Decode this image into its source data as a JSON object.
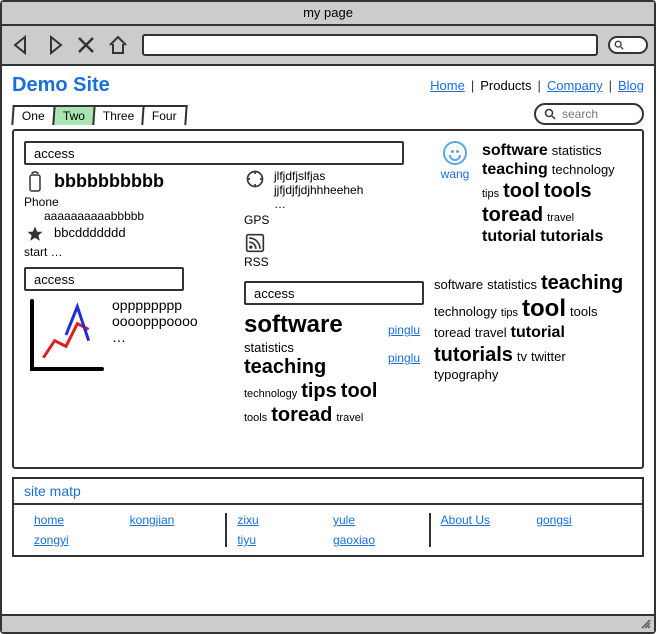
{
  "window": {
    "title": "my page"
  },
  "brand": "Demo Site",
  "menu": [
    {
      "label": "Home",
      "link": true
    },
    {
      "label": "Products",
      "link": false
    },
    {
      "label": "Company",
      "link": true
    },
    {
      "label": "Blog",
      "link": true
    }
  ],
  "search_placeholder": "search",
  "tabs": [
    "One",
    "Two",
    "Three",
    "Four"
  ],
  "active_tab": 1,
  "left": {
    "box1_label": "access",
    "phone_big": "bbbbbbbbbb",
    "phone_label": "Phone",
    "phone_sub": "aaaaaaaaaabbbbb",
    "star_text": "bbcddddddd",
    "start_text": "start …",
    "box2_label": "access",
    "opp1": "opppppppp",
    "opp2": "oooopppoooo",
    "opp3": "…"
  },
  "mid": {
    "gps_line1": "jlfjdfjslfjas",
    "gps_line2": "jjfjdjfjdjhhheeheh",
    "gps_line3": "…",
    "gps_label": "GPS",
    "rss_label": "RSS",
    "box_label": "access",
    "cloud": [
      {
        "t": "software",
        "w": 5
      },
      {
        "t": "statistics",
        "w": 2
      },
      {
        "t": "teaching",
        "w": 4
      },
      {
        "t": "technology",
        "w": 1
      },
      {
        "t": "tips",
        "w": 4
      },
      {
        "t": "tool",
        "w": 4
      },
      {
        "t": "tools",
        "w": 1
      },
      {
        "t": "toread",
        "w": 4
      },
      {
        "t": "travel",
        "w": 1
      }
    ],
    "links": [
      "pinglu",
      "pinglu"
    ]
  },
  "right": {
    "avatar_name": "wang",
    "cloud1": [
      {
        "t": "software",
        "w": 3
      },
      {
        "t": "statistics",
        "w": 2
      },
      {
        "t": "teaching",
        "w": 3
      },
      {
        "t": "technology",
        "w": 2
      },
      {
        "t": "tips",
        "w": 1
      },
      {
        "t": "tool",
        "w": 4
      },
      {
        "t": "tools",
        "w": 4
      },
      {
        "t": "toread",
        "w": 4
      },
      {
        "t": "travel",
        "w": 1
      },
      {
        "t": "tutorial",
        "w": 3
      },
      {
        "t": "tutorials",
        "w": 3
      }
    ],
    "cloud2": [
      {
        "t": "software",
        "w": 2
      },
      {
        "t": "statistics",
        "w": 2
      },
      {
        "t": "teaching",
        "w": 4
      },
      {
        "t": "technology",
        "w": 2
      },
      {
        "t": "tips",
        "w": 1
      },
      {
        "t": "tool",
        "w": 5
      },
      {
        "t": "tools",
        "w": 2
      },
      {
        "t": "toread",
        "w": 2
      },
      {
        "t": "travel",
        "w": 2
      },
      {
        "t": "tutorial",
        "w": 3
      },
      {
        "t": "tutorials",
        "w": 4
      },
      {
        "t": "tv",
        "w": 2
      },
      {
        "t": "twitter",
        "w": 2
      },
      {
        "t": "typography",
        "w": 2
      }
    ]
  },
  "sitemap_header": "site matp",
  "sitemap": {
    "col1": [
      "home",
      "kongjian",
      "zongyi",
      ""
    ],
    "col2": [
      "zixu",
      "yule",
      "tiyu",
      "gaoxiao"
    ],
    "col3": [
      "About Us",
      "gongsi"
    ]
  },
  "chart_data": {
    "type": "line",
    "x": [
      1,
      2,
      3,
      4,
      5
    ],
    "series": [
      {
        "name": "red",
        "values": [
          10,
          25,
          20,
          40,
          35
        ],
        "color": "#e02020"
      },
      {
        "name": "blue",
        "values": [
          null,
          null,
          30,
          55,
          25
        ],
        "color": "#2030d0"
      }
    ],
    "xlim": [
      0,
      6
    ],
    "ylim": [
      0,
      60
    ]
  }
}
